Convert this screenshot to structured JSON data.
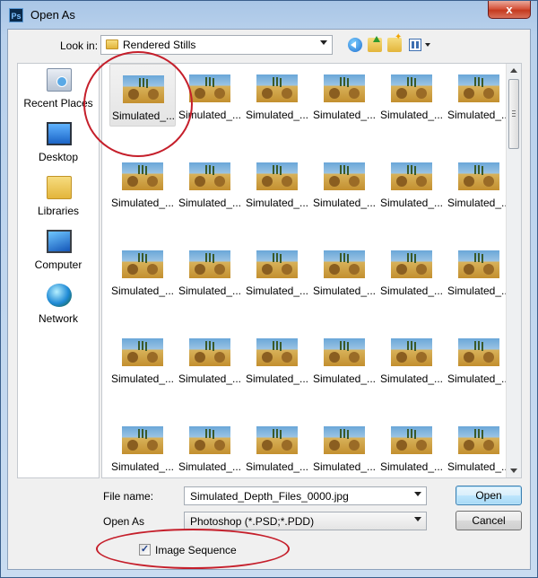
{
  "window": {
    "title": "Open As",
    "app_icon_text": "Ps",
    "close_glyph": "x"
  },
  "toolbar": {
    "look_in_label": "Look in:",
    "look_in_value": "Rendered Stills",
    "icons": [
      "back-icon",
      "up-folder-icon",
      "new-folder-icon",
      "views-menu-icon"
    ]
  },
  "places": [
    {
      "label": "Recent Places",
      "icon": "recent-places-icon"
    },
    {
      "label": "Desktop",
      "icon": "desktop-icon"
    },
    {
      "label": "Libraries",
      "icon": "libraries-icon"
    },
    {
      "label": "Computer",
      "icon": "computer-icon"
    },
    {
      "label": "Network",
      "icon": "network-icon"
    }
  ],
  "files": {
    "tile_label": "Simulated_...",
    "rows": 5,
    "columns": 6,
    "selected_index": 0
  },
  "form": {
    "file_name_label": "File name:",
    "file_name_value": "Simulated_Depth_Files_0000.jpg",
    "open_as_label": "Open As",
    "open_as_value": "Photoshop (*.PSD;*.PDD)",
    "open_button": "Open",
    "cancel_button": "Cancel",
    "image_sequence_label": "Image Sequence",
    "image_sequence_checked": true
  },
  "colors": {
    "annotation": "#c51f2b",
    "title_bar": "#b9d1ec",
    "close_button": "#c43a1f"
  }
}
